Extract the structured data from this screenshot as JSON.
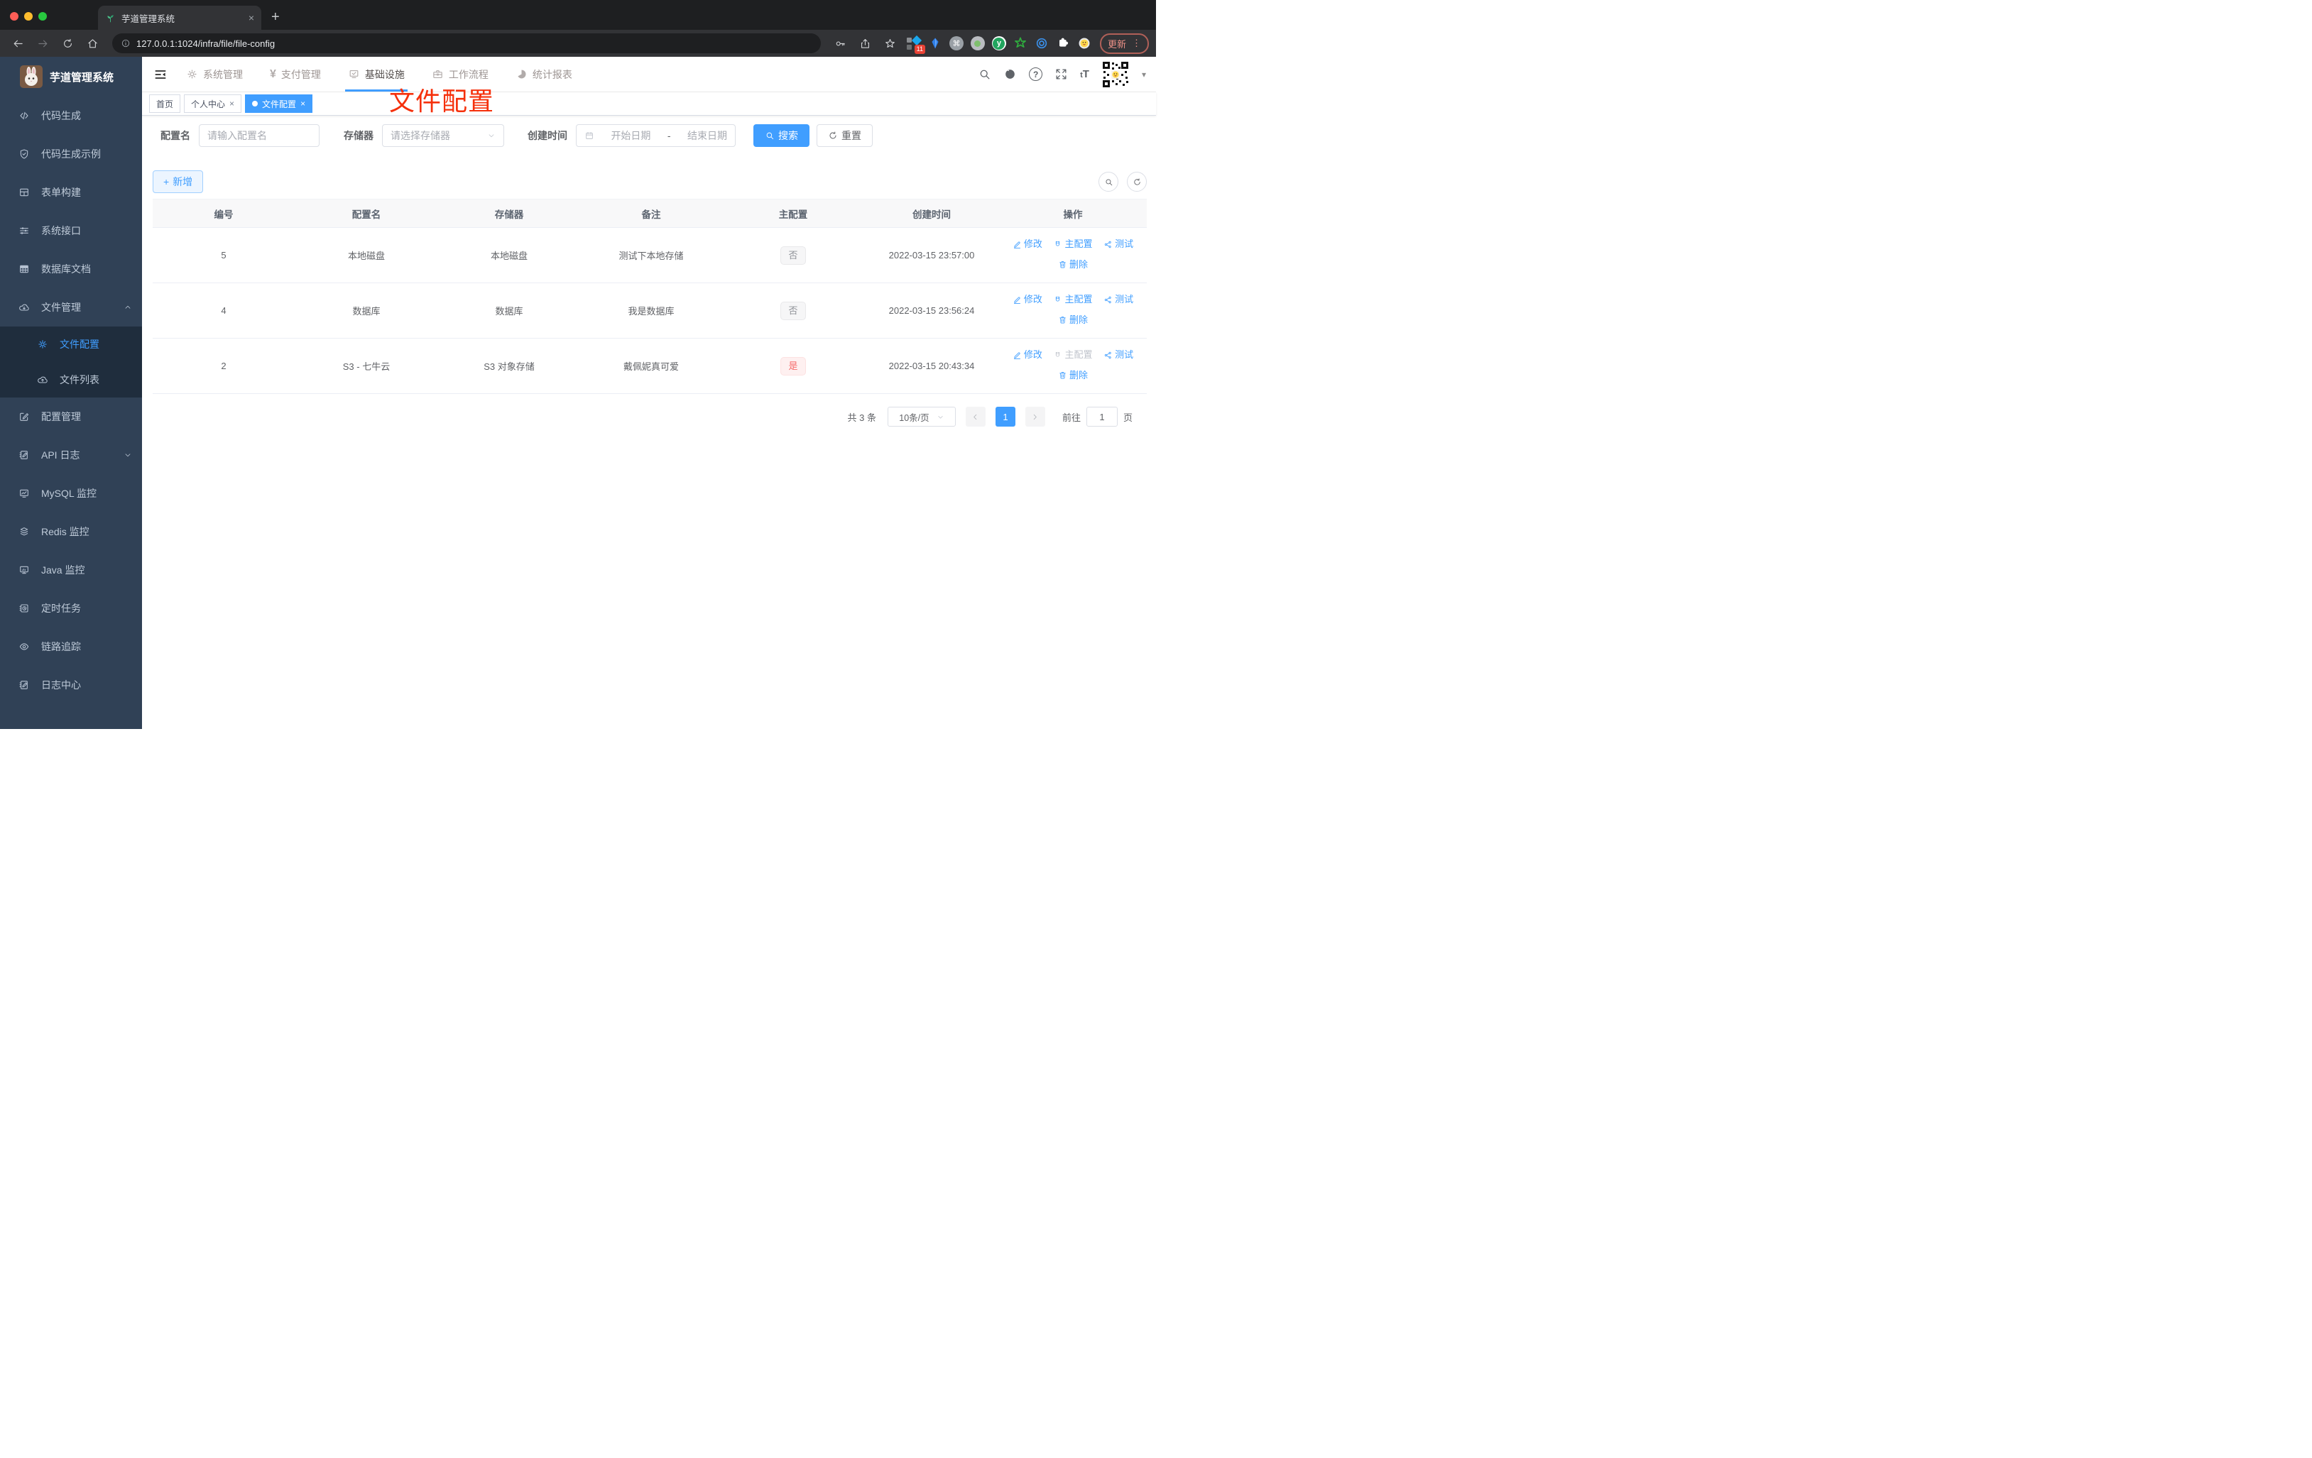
{
  "browser": {
    "tab_title": "芋道管理系统",
    "url": "127.0.0.1:1024/infra/file/file-config",
    "update_label": "更新",
    "extension_badge": "11"
  },
  "sidebar": {
    "logo_title": "芋道管理系统",
    "items": [
      {
        "label": "代码生成",
        "icon": "code-icon"
      },
      {
        "label": "代码生成示例",
        "icon": "shield-check-icon"
      },
      {
        "label": "表单构建",
        "icon": "form-builder-icon"
      },
      {
        "label": "系统接口",
        "icon": "sliders-icon"
      },
      {
        "label": "数据库文档",
        "icon": "database-doc-icon"
      },
      {
        "label": "文件管理",
        "icon": "cloud-download-icon"
      },
      {
        "label": "配置管理",
        "icon": "edit-square-icon"
      },
      {
        "label": "API 日志",
        "icon": "document-edit-icon"
      },
      {
        "label": "MySQL 监控",
        "icon": "chart-monitor-icon"
      },
      {
        "label": "Redis 监控",
        "icon": "layers-icon"
      },
      {
        "label": "Java 监控",
        "icon": "monitor-icon"
      },
      {
        "label": "定时任务",
        "icon": "schedule-icon"
      },
      {
        "label": "链路追踪",
        "icon": "eye-icon"
      },
      {
        "label": "日志中心",
        "icon": "log-edit-icon"
      }
    ],
    "file_submenu": [
      {
        "label": "文件配置",
        "icon": "gear-icon",
        "active": true
      },
      {
        "label": "文件列表",
        "icon": "cloud-upload-icon",
        "active": false
      }
    ]
  },
  "topnav": {
    "items": [
      {
        "label": "系统管理",
        "icon": "gear-icon"
      },
      {
        "label": "支付管理",
        "icon": "yen-icon"
      },
      {
        "label": "基础设施",
        "icon": "monitor-check-icon",
        "active": true
      },
      {
        "label": "工作流程",
        "icon": "briefcase-icon"
      },
      {
        "label": "统计报表",
        "icon": "pie-chart-icon"
      }
    ],
    "font_size_icon": "tT"
  },
  "tags": [
    {
      "label": "首页",
      "closable": false,
      "active": false
    },
    {
      "label": "个人中心",
      "closable": true,
      "active": false
    },
    {
      "label": "文件配置",
      "closable": true,
      "active": true
    }
  ],
  "annotation": {
    "text": "文件配置",
    "color": "#f5300b"
  },
  "filters": {
    "name_label": "配置名",
    "name_placeholder": "请输入配置名",
    "storage_label": "存储器",
    "storage_placeholder": "请选择存储器",
    "time_label": "创建时间",
    "start_placeholder": "开始日期",
    "range_separator": "-",
    "end_placeholder": "结束日期",
    "search_label": "搜索",
    "reset_label": "重置"
  },
  "toolbar": {
    "add_label": "新增"
  },
  "table": {
    "columns": [
      "编号",
      "配置名",
      "存储器",
      "备注",
      "主配置",
      "创建时间",
      "操作"
    ],
    "actions": {
      "edit": "修改",
      "master": "主配置",
      "test": "测试",
      "remove": "删除"
    },
    "rows": [
      {
        "id": "5",
        "name": "本地磁盘",
        "storage": "本地磁盘",
        "remark": "测试下本地存储",
        "primary": "否",
        "time": "2022-03-15 23:57:00",
        "master_disabled": false
      },
      {
        "id": "4",
        "name": "数据库",
        "storage": "数据库",
        "remark": "我是数据库",
        "primary": "否",
        "time": "2022-03-15 23:56:24",
        "master_disabled": false
      },
      {
        "id": "2",
        "name": "S3 - 七牛云",
        "storage": "S3 对象存储",
        "remark": "戴佩妮真可爱",
        "primary": "是",
        "time": "2022-03-15 20:43:34",
        "master_disabled": true
      }
    ]
  },
  "pagination": {
    "total_label": "共 3 条",
    "page_size": "10条/页",
    "current_page": "1",
    "goto_label": "前往",
    "goto_value": "1",
    "page_unit": "页"
  },
  "colors": {
    "primary": "#409eff",
    "danger": "#f56c6c",
    "sidebar_bg": "#304156",
    "submenu_bg": "#1f2d3d",
    "annotation": "#f5300b"
  }
}
